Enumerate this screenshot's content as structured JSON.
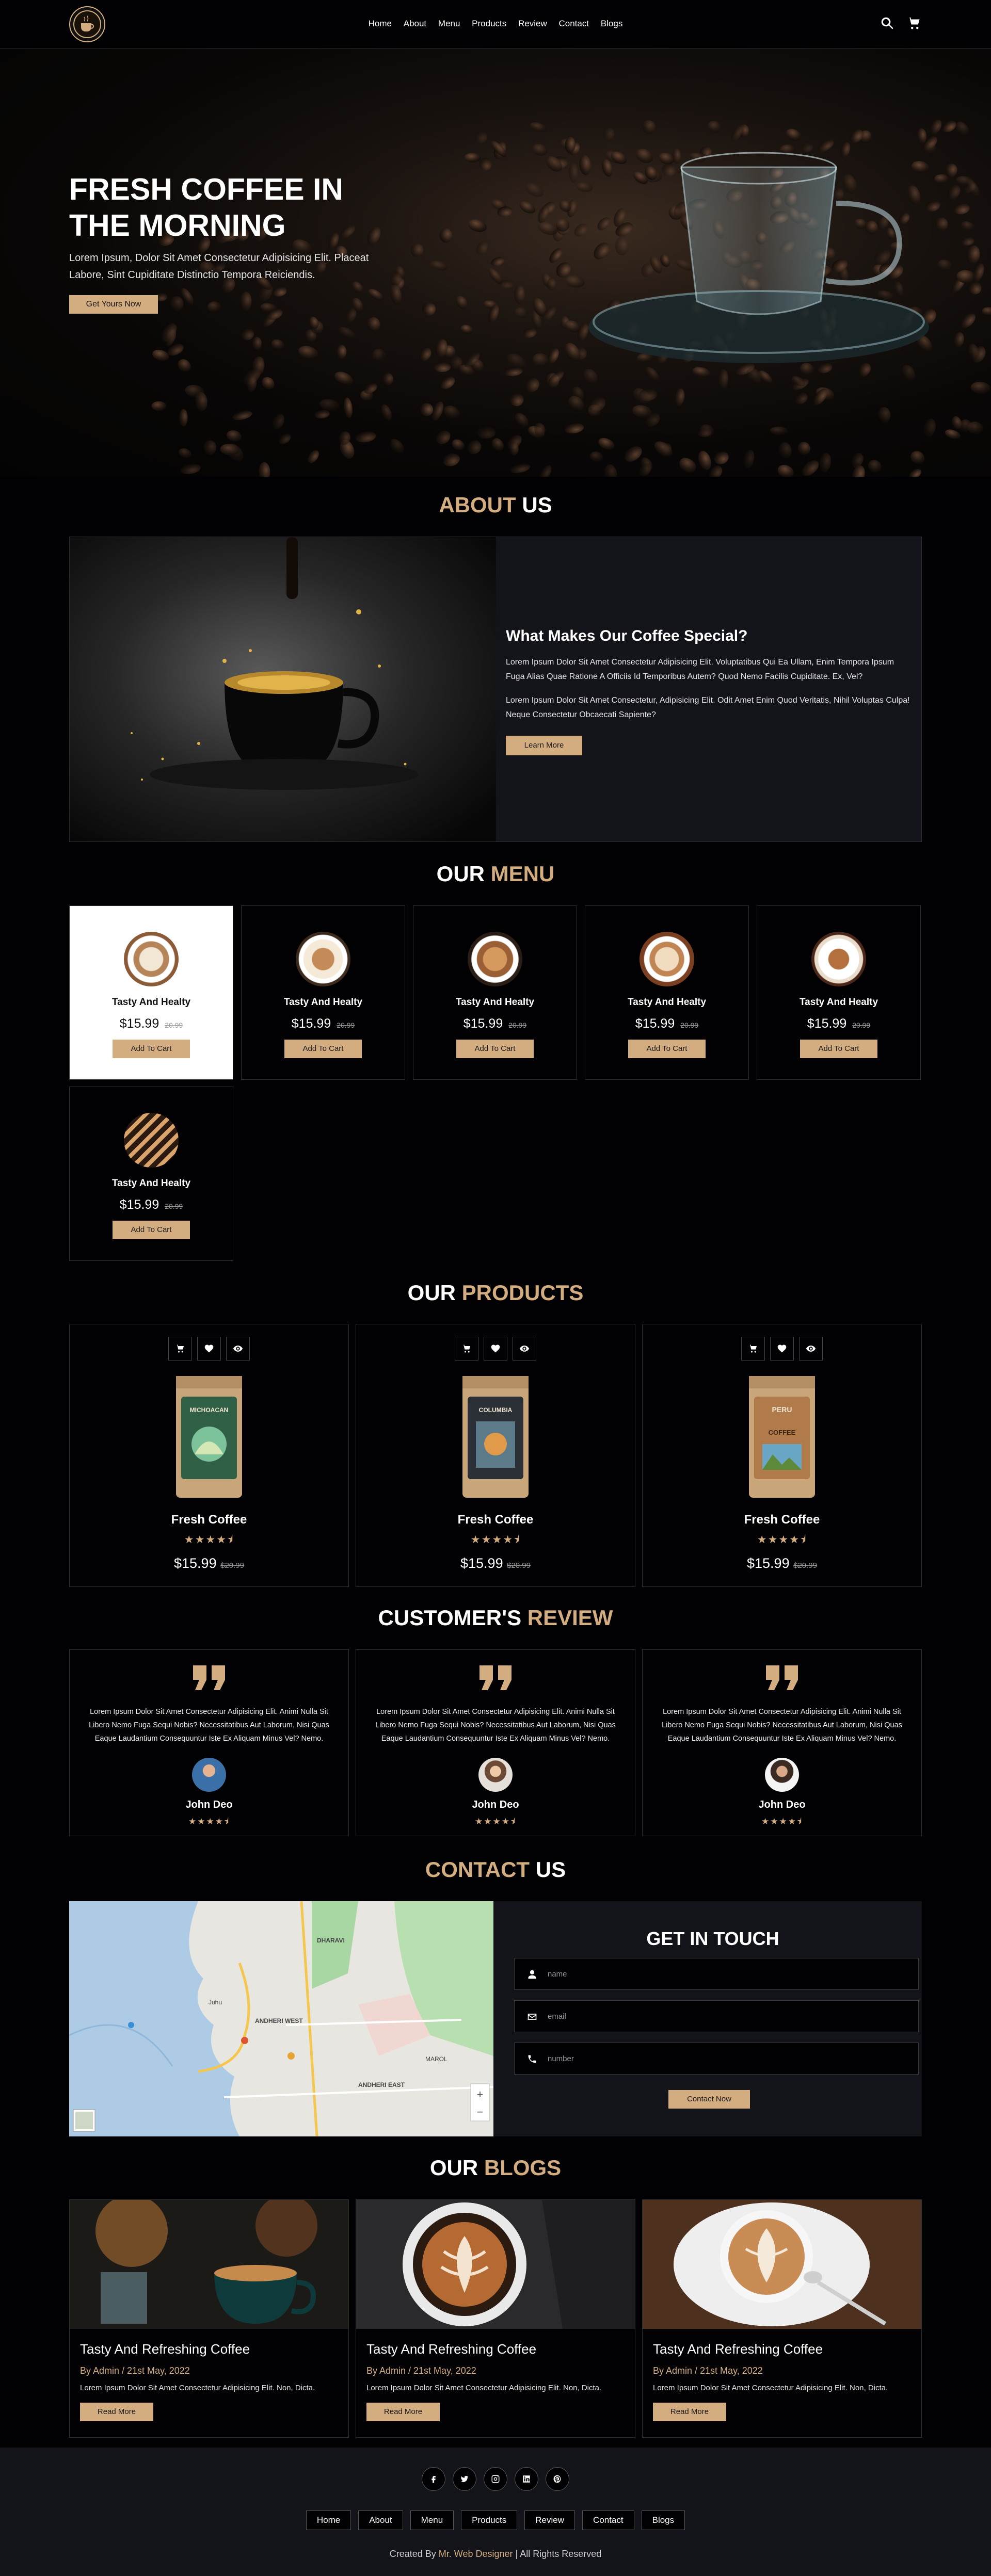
{
  "nav": {
    "logo_alt": "coffee shop logo",
    "links": [
      "Home",
      "About",
      "Menu",
      "Products",
      "Review",
      "Contact",
      "Blogs"
    ],
    "search_icon": "search-icon",
    "cart_icon": "cart-icon"
  },
  "hero": {
    "title": "Fresh Coffee In The Morning",
    "text": "Lorem Ipsum, Dolor Sit Amet Consectetur Adipisicing Elit. Placeat Labore, Sint Cupiditate Distinctio Tempora Reiciendis.",
    "button": "Get Yours Now"
  },
  "about": {
    "title_a": "About",
    "title_b": "Us",
    "heading": "What Makes Our Coffee Special?",
    "p1": "Lorem Ipsum Dolor Sit Amet Consectetur Adipisicing Elit. Voluptatibus Qui Ea Ullam, Enim Tempora Ipsum Fuga Alias Quae Ratione A Officiis Id Temporibus Autem? Quod Nemo Facilis Cupiditate. Ex, Vel?",
    "p2": "Lorem Ipsum Dolor Sit Amet Consectetur, Adipisicing Elit. Odit Amet Enim Quod Veritatis, Nihil Voluptas Culpa! Neque Consectetur Obcaecati Sapiente?",
    "button": "Learn More"
  },
  "menu": {
    "title_a": "Our",
    "title_b": "Menu",
    "items": [
      {
        "name": "Tasty And Healty",
        "price": "$15.99",
        "old": "20.99",
        "button": "Add To Cart"
      },
      {
        "name": "Tasty And Healty",
        "price": "$15.99",
        "old": "20.99",
        "button": "Add To Cart"
      },
      {
        "name": "Tasty And Healty",
        "price": "$15.99",
        "old": "20.99",
        "button": "Add To Cart"
      },
      {
        "name": "Tasty And Healty",
        "price": "$15.99",
        "old": "20.99",
        "button": "Add To Cart"
      },
      {
        "name": "Tasty And Healty",
        "price": "$15.99",
        "old": "20.99",
        "button": "Add To Cart"
      },
      {
        "name": "Tasty And Healty",
        "price": "$15.99",
        "old": "20.99",
        "button": "Add To Cart"
      }
    ]
  },
  "products": {
    "title_a": "Our",
    "title_b": "Products",
    "items": [
      {
        "name": "Fresh Coffee",
        "bag_label": "MICHOACAN",
        "bag_color": "#2f5f45",
        "rating": "4.5",
        "price": "$15.99",
        "old": "$20.99"
      },
      {
        "name": "Fresh Coffee",
        "bag_label": "COLUMBIA",
        "bag_color": "#2b2f36",
        "rating": "4.5",
        "price": "$15.99",
        "old": "$20.99"
      },
      {
        "name": "Fresh Coffee",
        "bag_label": "PERU",
        "bag_color": "#b07a4a",
        "rating": "4.5",
        "price": "$15.99",
        "old": "$20.99"
      }
    ]
  },
  "review": {
    "title_a": "Customer's",
    "title_b": "Review",
    "items": [
      {
        "text": "Lorem Ipsum Dolor Sit Amet Consectetur Adipisicing Elit. Animi Nulla Sit Libero Nemo Fuga Sequi Nobis? Necessitatibus Aut Laborum, Nisi Quas Eaque Laudantium Consequuntur Iste Ex Aliquam Minus Vel? Nemo.",
        "name": "John Deo",
        "rating": "4.5"
      },
      {
        "text": "Lorem Ipsum Dolor Sit Amet Consectetur Adipisicing Elit. Animi Nulla Sit Libero Nemo Fuga Sequi Nobis? Necessitatibus Aut Laborum, Nisi Quas Eaque Laudantium Consequuntur Iste Ex Aliquam Minus Vel? Nemo.",
        "name": "John Deo",
        "rating": "4.5"
      },
      {
        "text": "Lorem Ipsum Dolor Sit Amet Consectetur Adipisicing Elit. Animi Nulla Sit Libero Nemo Fuga Sequi Nobis? Necessitatibus Aut Laborum, Nisi Quas Eaque Laudantium Consequuntur Iste Ex Aliquam Minus Vel? Nemo.",
        "name": "John Deo",
        "rating": "4.5"
      }
    ]
  },
  "contact": {
    "title_a": "Contact",
    "title_b": "Us",
    "heading": "Get In Touch",
    "placeholders": [
      "name",
      "email",
      "number"
    ],
    "button": "Contact Now",
    "map_labels": [
      "ANDHERI WEST",
      "ANDHERI EAST",
      "DHARAVI",
      "Juhu",
      "MAROL"
    ]
  },
  "blogs": {
    "title_a": "Our",
    "title_b": "Blogs",
    "items": [
      {
        "title": "Tasty And Refreshing Coffee",
        "meta": "By Admin / 21st May, 2022",
        "text": "Lorem Ipsum Dolor Sit Amet Consectetur Adipisicing Elit. Non, Dicta.",
        "button": "Read More"
      },
      {
        "title": "Tasty And Refreshing Coffee",
        "meta": "By Admin / 21st May, 2022",
        "text": "Lorem Ipsum Dolor Sit Amet Consectetur Adipisicing Elit. Non, Dicta.",
        "button": "Read More"
      },
      {
        "title": "Tasty And Refreshing Coffee",
        "meta": "By Admin / 21st May, 2022",
        "text": "Lorem Ipsum Dolor Sit Amet Consectetur Adipisicing Elit. Non, Dicta.",
        "button": "Read More"
      }
    ]
  },
  "footer": {
    "socials": [
      "facebook-icon",
      "twitter-icon",
      "instagram-icon",
      "linkedin-icon",
      "pinterest-icon"
    ],
    "links": [
      "Home",
      "About",
      "Menu",
      "Products",
      "Review",
      "Contact",
      "Blogs"
    ],
    "credit_a": "Created By",
    "credit_b": "Mr. Web Designer",
    "credit_c": "| All Rights Reserved"
  },
  "colors": {
    "accent": "#d3ad7f",
    "background": "#010103",
    "panel": "#13131a"
  }
}
